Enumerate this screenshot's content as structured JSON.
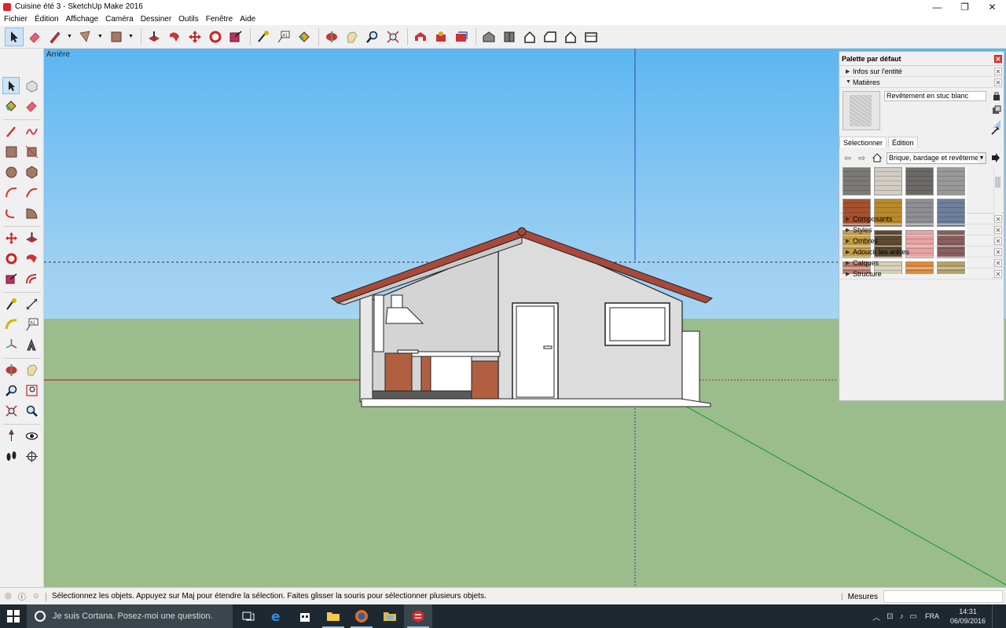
{
  "window": {
    "title": "Cuisine été 3 - SketchUp Make 2016",
    "minimize": "—",
    "maximize": "❐",
    "close": "✕"
  },
  "menu": [
    "Fichier",
    "Édition",
    "Affichage",
    "Caméra",
    "Dessiner",
    "Outils",
    "Fenêtre",
    "Aide"
  ],
  "viewport": {
    "scene_label": "Arrière"
  },
  "tray": {
    "title": "Palette par défaut",
    "close": "✕",
    "entity_info": "Infos sur l'entité",
    "materials": "Matières",
    "material_name": "Revêtement en stuc blanc",
    "tab_select": "Sélectionner",
    "tab_edit": "Édition",
    "library": "Brique, bardage et revêtement",
    "sections": [
      "Composants",
      "Styles",
      "Ombres",
      "Adoucir les arêtes",
      "Calques",
      "Structure"
    ],
    "swatch_colors": [
      "#7b7a76",
      "#d2cdc4",
      "#6c6a67",
      "#9a9999",
      "#a8502e",
      "#b98a2a",
      "#8f8f93",
      "#6d7f9c",
      "#c79f45",
      "#5e4a32",
      "#e9a2a2",
      "#8a5f5f",
      "#c27e68",
      "#d6d0b2",
      "#e08a3c",
      "#b4a46a"
    ]
  },
  "status": {
    "message": "Sélectionnez les objets. Appuyez sur Maj pour étendre la sélection. Faites glisser la souris pour sélectionner plusieurs objets.",
    "measures_label": "Mesures",
    "measures_value": ""
  },
  "taskbar": {
    "cortana_placeholder": "Je suis Cortana. Posez-moi une question.",
    "lang": "FRA",
    "time": "14:31",
    "date": "06/09/2016"
  }
}
